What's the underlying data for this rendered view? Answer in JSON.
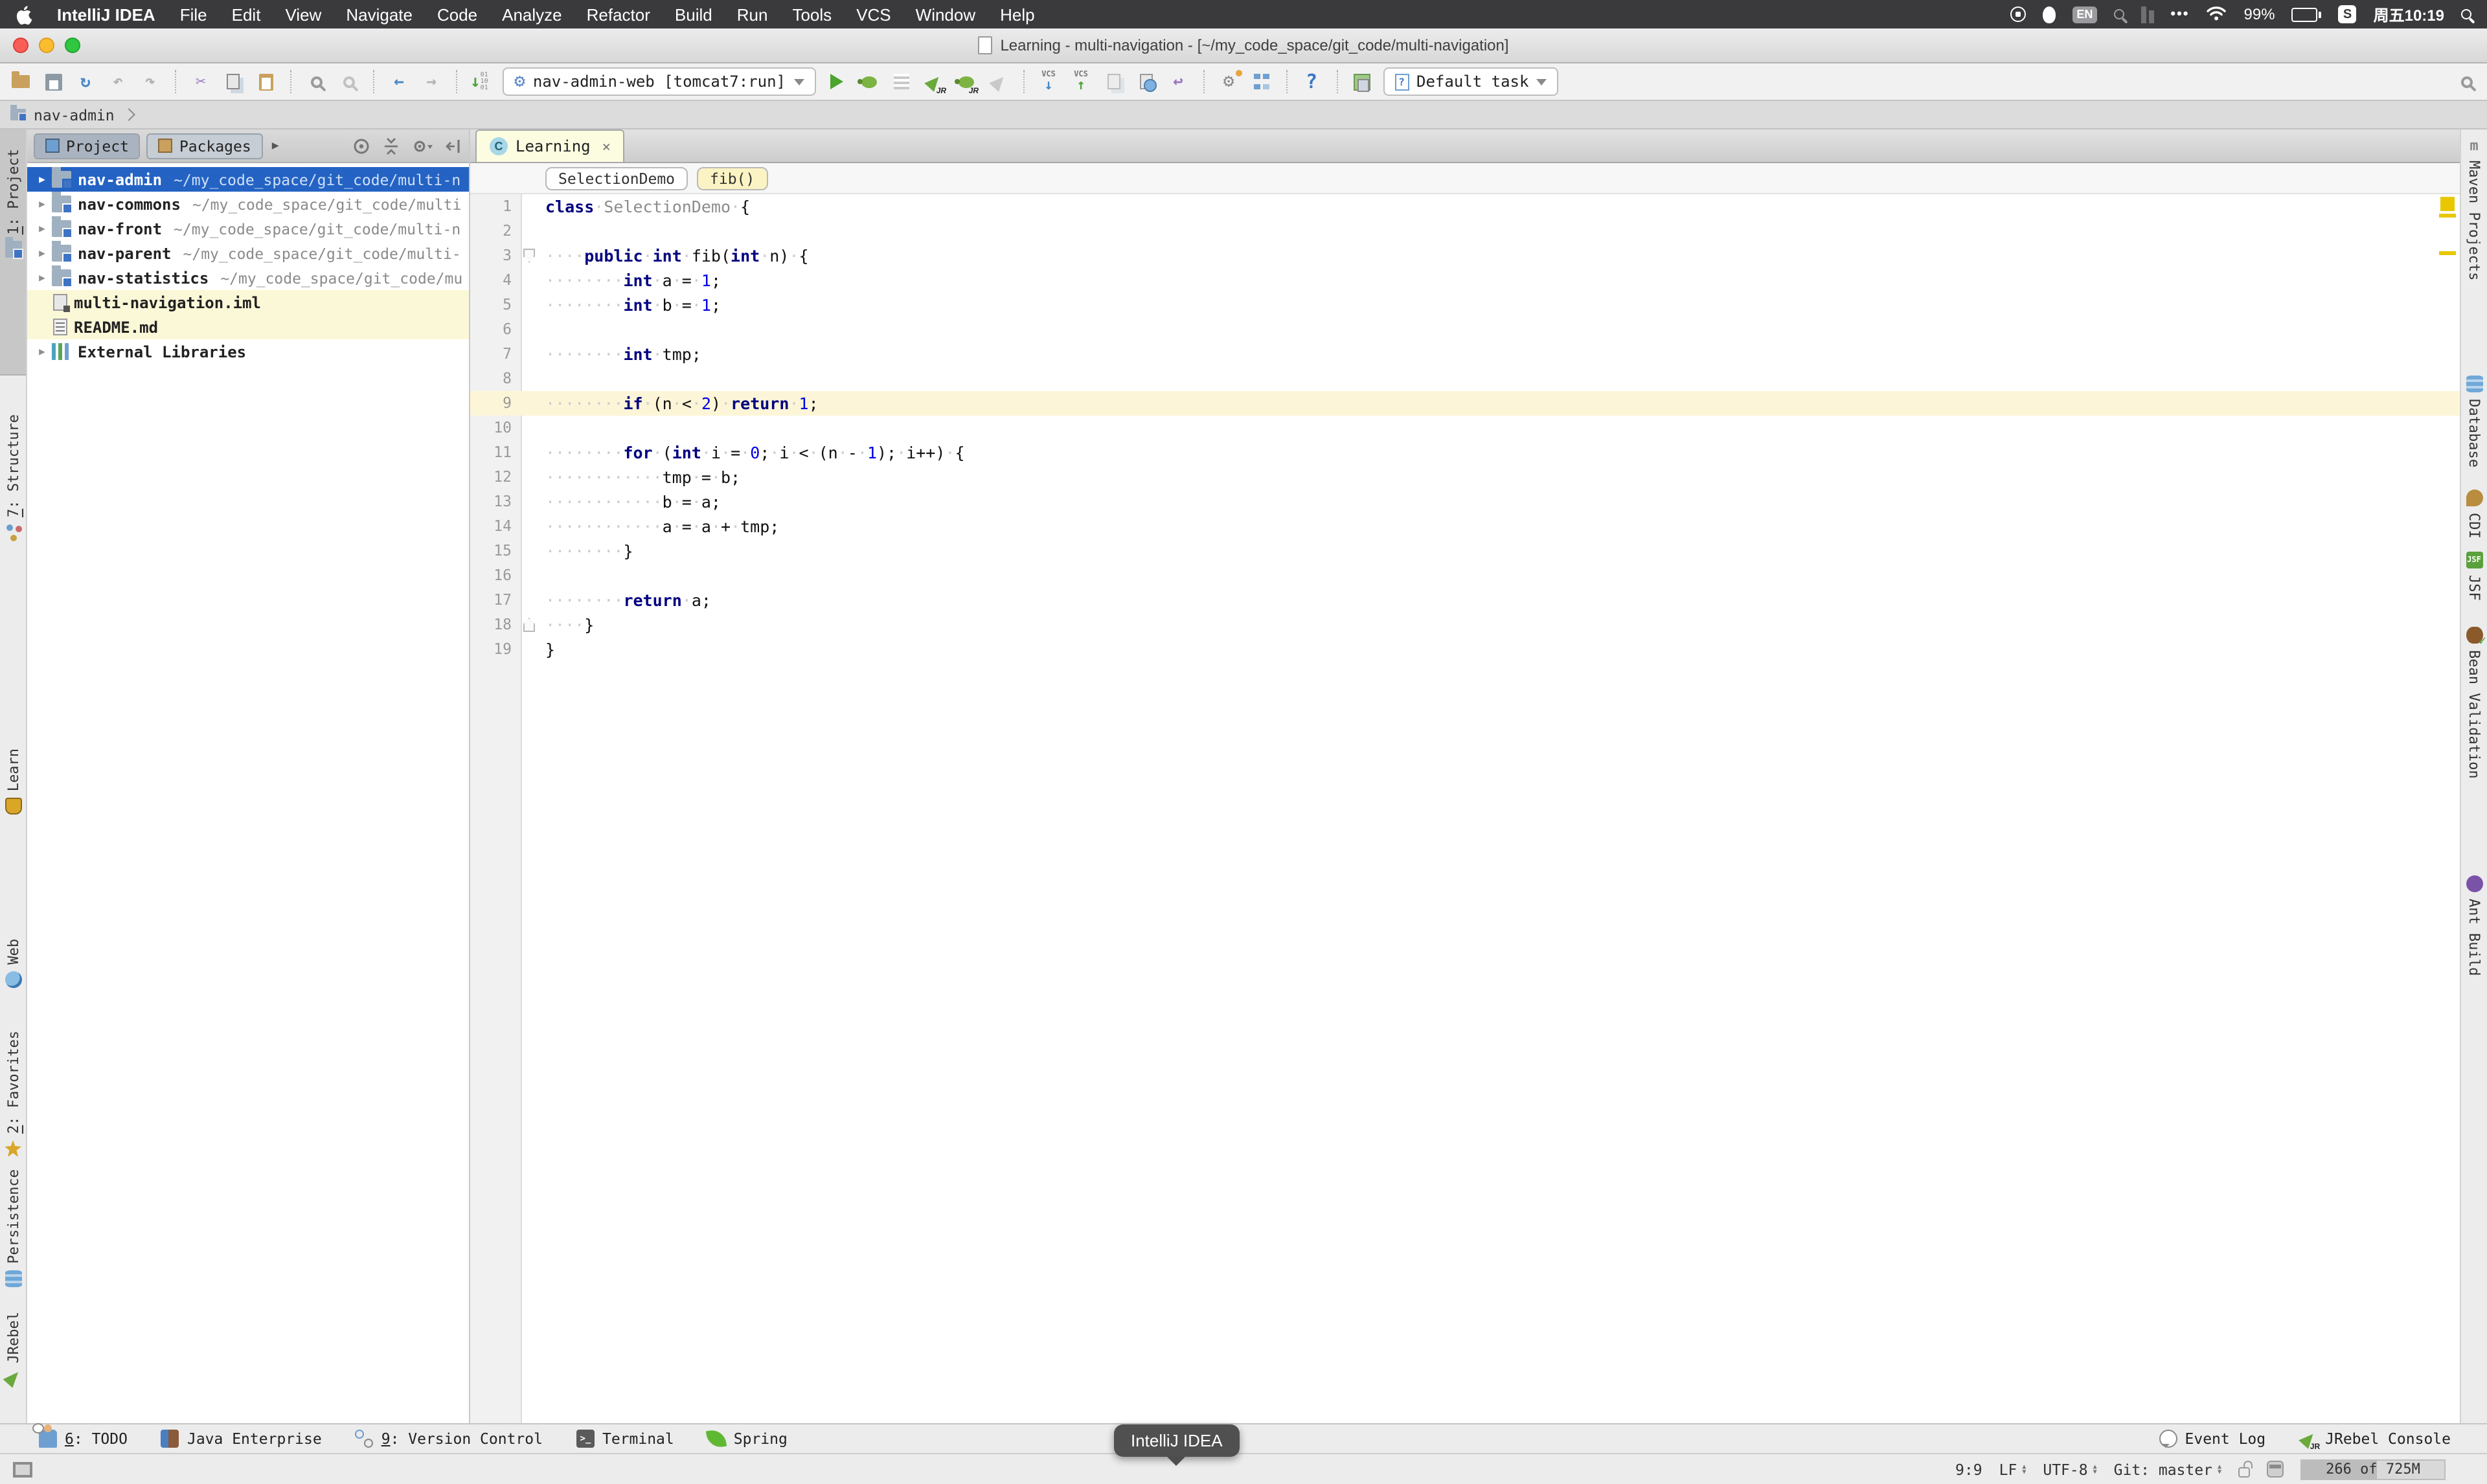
{
  "colors": {
    "selection": "#2463c4",
    "warning_stripe": "#e9c700",
    "run_green": "#4aa42e",
    "tab_cream": "#fcfce1"
  },
  "menubar": {
    "app": "IntelliJ IDEA",
    "menus": [
      "File",
      "Edit",
      "View",
      "Navigate",
      "Code",
      "Analyze",
      "Refactor",
      "Build",
      "Run",
      "Tools",
      "VCS",
      "Window",
      "Help"
    ],
    "right": {
      "input": "EN",
      "more": "•••",
      "battery": "99%",
      "s_badge": "S",
      "clock": "周五10:19"
    }
  },
  "titlebar": {
    "title": "Learning - multi-navigation - [~/my_code_space/git_code/multi-navigation]"
  },
  "toolbar": {
    "run_config": "nav-admin-web [tomcat7:run]",
    "task": "Default task",
    "vcs": "VCS",
    "hex": "01\n10\n01"
  },
  "navbar": {
    "crumb": "nav-admin"
  },
  "project": {
    "tabs": [
      "Project",
      "Packages"
    ],
    "tree": [
      {
        "name": "nav-admin",
        "path": "~/my_code_space/git_code/multi-n",
        "kind": "module",
        "arrow": true,
        "selected": true
      },
      {
        "name": "nav-commons",
        "path": "~/my_code_space/git_code/multi",
        "kind": "module",
        "arrow": true
      },
      {
        "name": "nav-front",
        "path": "~/my_code_space/git_code/multi-n",
        "kind": "module",
        "arrow": true
      },
      {
        "name": "nav-parent",
        "path": "~/my_code_space/git_code/multi-",
        "kind": "module",
        "arrow": true
      },
      {
        "name": "nav-statistics",
        "path": "~/my_code_space/git_code/mu",
        "kind": "module",
        "arrow": true
      },
      {
        "name": "multi-navigation.iml",
        "kind": "iml",
        "highlight": true
      },
      {
        "name": "README.md",
        "kind": "md",
        "highlight": true
      },
      {
        "name": "External Libraries",
        "kind": "lib",
        "arrow": true
      }
    ]
  },
  "editor": {
    "tab": "Learning",
    "close": "×",
    "crumbs": [
      "SelectionDemo",
      "fib()"
    ],
    "lines": [
      {
        "n": 1,
        "seg": [
          [
            "kw",
            "class"
          ],
          [
            "ws",
            "·"
          ],
          [
            "cn",
            "SelectionDemo"
          ],
          [
            "ws",
            "·"
          ],
          [
            "pl",
            "{"
          ]
        ]
      },
      {
        "n": 2,
        "seg": []
      },
      {
        "n": 3,
        "fold": "open",
        "seg": [
          [
            "ws",
            "····"
          ],
          [
            "kw",
            "public"
          ],
          [
            "ws",
            "·"
          ],
          [
            "kw",
            "int"
          ],
          [
            "ws",
            "·"
          ],
          [
            "pl",
            "fib("
          ],
          [
            "kw",
            "int"
          ],
          [
            "ws",
            "·"
          ],
          [
            "pl",
            "n)"
          ],
          [
            "ws",
            "·"
          ],
          [
            "pl",
            "{"
          ]
        ]
      },
      {
        "n": 4,
        "seg": [
          [
            "ws",
            "········"
          ],
          [
            "kw",
            "int"
          ],
          [
            "ws",
            "·"
          ],
          [
            "pl",
            "a"
          ],
          [
            "ws",
            "·"
          ],
          [
            "pl",
            "="
          ],
          [
            "ws",
            "·"
          ],
          [
            "num",
            "1"
          ],
          [
            "pl",
            ";"
          ]
        ]
      },
      {
        "n": 5,
        "seg": [
          [
            "ws",
            "········"
          ],
          [
            "kw",
            "int"
          ],
          [
            "ws",
            "·"
          ],
          [
            "pl",
            "b"
          ],
          [
            "ws",
            "·"
          ],
          [
            "pl",
            "="
          ],
          [
            "ws",
            "·"
          ],
          [
            "num",
            "1"
          ],
          [
            "pl",
            ";"
          ]
        ]
      },
      {
        "n": 6,
        "seg": []
      },
      {
        "n": 7,
        "seg": [
          [
            "ws",
            "········"
          ],
          [
            "kw",
            "int"
          ],
          [
            "ws",
            "·"
          ],
          [
            "pl",
            "tmp;"
          ]
        ]
      },
      {
        "n": 8,
        "seg": []
      },
      {
        "n": 9,
        "hl": true,
        "seg": [
          [
            "ws",
            "········"
          ],
          [
            "kw",
            "if"
          ],
          [
            "ws",
            "·"
          ],
          [
            "pl",
            "(n"
          ],
          [
            "ws",
            "·"
          ],
          [
            "pl",
            "<"
          ],
          [
            "ws",
            "·"
          ],
          [
            "num",
            "2"
          ],
          [
            "pl",
            ")"
          ],
          [
            "ws",
            "·"
          ],
          [
            "kw",
            "return"
          ],
          [
            "ws",
            "·"
          ],
          [
            "num",
            "1"
          ],
          [
            "pl",
            ";"
          ]
        ]
      },
      {
        "n": 10,
        "seg": []
      },
      {
        "n": 11,
        "seg": [
          [
            "ws",
            "········"
          ],
          [
            "kw",
            "for"
          ],
          [
            "ws",
            "·"
          ],
          [
            "pl",
            "("
          ],
          [
            "kw",
            "int"
          ],
          [
            "ws",
            "·"
          ],
          [
            "pl",
            "i"
          ],
          [
            "ws",
            "·"
          ],
          [
            "pl",
            "="
          ],
          [
            "ws",
            "·"
          ],
          [
            "num",
            "0"
          ],
          [
            "pl",
            ";"
          ],
          [
            "ws",
            "·"
          ],
          [
            "pl",
            "i"
          ],
          [
            "ws",
            "·"
          ],
          [
            "pl",
            "<"
          ],
          [
            "ws",
            "·"
          ],
          [
            "pl",
            "(n"
          ],
          [
            "ws",
            "·"
          ],
          [
            "pl",
            "-"
          ],
          [
            "ws",
            "·"
          ],
          [
            "num",
            "1"
          ],
          [
            "pl",
            ");"
          ],
          [
            "ws",
            "·"
          ],
          [
            "pl",
            "i++)"
          ],
          [
            "ws",
            "·"
          ],
          [
            "pl",
            "{"
          ]
        ]
      },
      {
        "n": 12,
        "seg": [
          [
            "ws",
            "············"
          ],
          [
            "pl",
            "tmp"
          ],
          [
            "ws",
            "·"
          ],
          [
            "pl",
            "="
          ],
          [
            "ws",
            "·"
          ],
          [
            "pl",
            "b;"
          ]
        ]
      },
      {
        "n": 13,
        "seg": [
          [
            "ws",
            "············"
          ],
          [
            "pl",
            "b"
          ],
          [
            "ws",
            "·"
          ],
          [
            "pl",
            "="
          ],
          [
            "ws",
            "·"
          ],
          [
            "pl",
            "a;"
          ]
        ]
      },
      {
        "n": 14,
        "seg": [
          [
            "ws",
            "············"
          ],
          [
            "pl",
            "a"
          ],
          [
            "ws",
            "·"
          ],
          [
            "pl",
            "="
          ],
          [
            "ws",
            "·"
          ],
          [
            "pl",
            "a"
          ],
          [
            "ws",
            "·"
          ],
          [
            "pl",
            "+"
          ],
          [
            "ws",
            "·"
          ],
          [
            "pl",
            "tmp;"
          ]
        ]
      },
      {
        "n": 15,
        "seg": [
          [
            "ws",
            "········"
          ],
          [
            "pl",
            "}"
          ]
        ]
      },
      {
        "n": 16,
        "seg": []
      },
      {
        "n": 17,
        "seg": [
          [
            "ws",
            "········"
          ],
          [
            "kw",
            "return"
          ],
          [
            "ws",
            "·"
          ],
          [
            "pl",
            "a;"
          ]
        ]
      },
      {
        "n": 18,
        "fold": "close",
        "seg": [
          [
            "ws",
            "····"
          ],
          [
            "pl",
            "}"
          ]
        ]
      },
      {
        "n": 19,
        "seg": [
          [
            "pl",
            "}"
          ]
        ]
      }
    ]
  },
  "stripes": {
    "left": [
      {
        "pre": "1",
        "rest": ": Project",
        "icon": "folder",
        "active": true
      },
      {
        "pre": "7",
        "rest": ": Structure",
        "icon": "structure"
      },
      {
        "pre": "",
        "rest": "Learn",
        "icon": "learn"
      },
      {
        "pre": "",
        "rest": "Web",
        "icon": "globe"
      },
      {
        "pre": "2",
        "rest": ": Favorites",
        "icon": "star"
      },
      {
        "pre": "",
        "rest": "Persistence",
        "icon": "db"
      },
      {
        "pre": "",
        "rest": "JRebel",
        "icon": "rocket"
      }
    ],
    "right": [
      {
        "rest": "Maven Projects",
        "icon": "maven"
      },
      {
        "rest": "Database",
        "icon": "db"
      },
      {
        "rest": "CDI",
        "icon": "cdi"
      },
      {
        "rest": "JSF",
        "icon": "jsf"
      },
      {
        "rest": "Bean Validation",
        "icon": "bean"
      },
      {
        "rest": "Ant Build",
        "icon": "ant"
      }
    ]
  },
  "toolwindow_bar": {
    "left": [
      {
        "pre": "6",
        "rest": ": TODO",
        "icon": "todo"
      },
      {
        "pre": "",
        "rest": "Java Enterprise",
        "icon": "jee"
      },
      {
        "pre": "9",
        "rest": ": Version Control",
        "icon": "vcs"
      },
      {
        "pre": "",
        "rest": "Terminal",
        "icon": "terminal"
      },
      {
        "pre": "",
        "rest": "Spring",
        "icon": "spring"
      }
    ],
    "right": [
      {
        "pre": "",
        "rest": "Event Log",
        "icon": "bubble"
      },
      {
        "pre": "",
        "rest": "JRebel Console",
        "icon": "jrebel"
      }
    ]
  },
  "status_bar": {
    "position": "9:9",
    "line_ending": "LF",
    "encoding": "UTF-8",
    "vcs_branch": "Git: master",
    "memory": "266 of 725M"
  },
  "tooltip": {
    "text": "IntelliJ IDEA"
  }
}
